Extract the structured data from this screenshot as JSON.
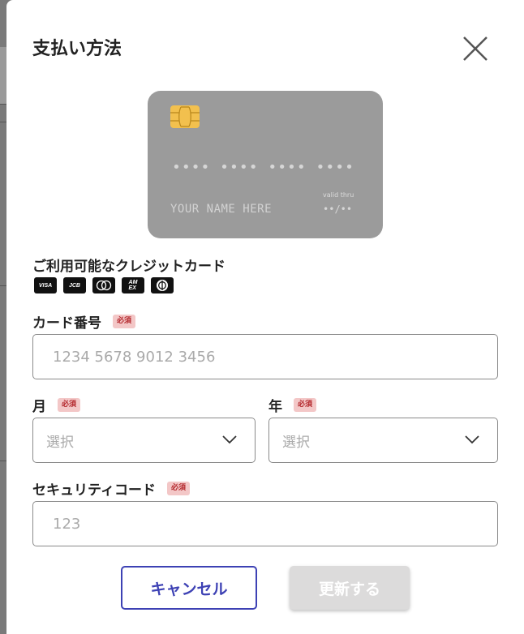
{
  "dialog": {
    "title": "支払い方法",
    "close_icon": "close-icon"
  },
  "card_preview": {
    "number": "•••• •••• •••• ••••",
    "name": "YOUR NAME HERE",
    "valid_label": "valid thru",
    "valid_value": "••/••",
    "chip_color": "#f2c04e",
    "card_color": "#9b9b9b"
  },
  "accepted_cards": {
    "label": "ご利用可能なクレジットカード",
    "brands": [
      "VISA",
      "JCB",
      "MasterCard",
      "AMEX",
      "Diners"
    ]
  },
  "form": {
    "required_badge": "必須",
    "card_number": {
      "label": "カード番号",
      "placeholder": "1234 5678 9012 3456"
    },
    "month": {
      "label": "月",
      "value": "選択"
    },
    "year": {
      "label": "年",
      "value": "選択"
    },
    "security_code": {
      "label": "セキュリティコード",
      "placeholder": "123"
    }
  },
  "actions": {
    "cancel_label": "キャンセル",
    "update_label": "更新する",
    "accent_color": "#3d41b4"
  }
}
